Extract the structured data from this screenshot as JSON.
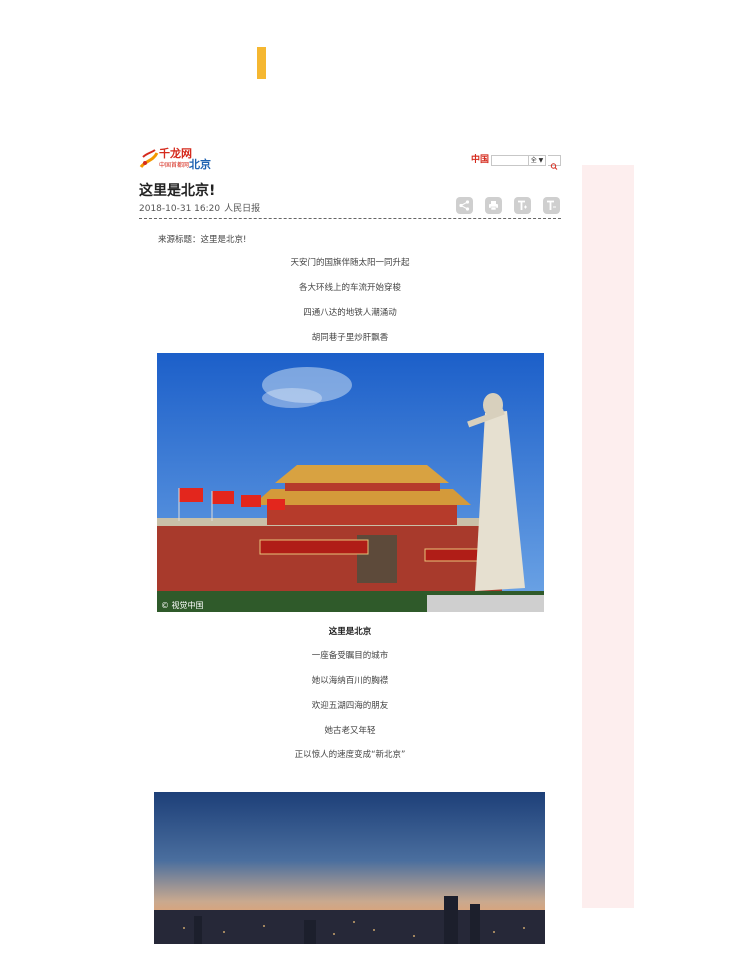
{
  "site": {
    "logo_name": "千龙网",
    "logo_sub": "中国首都网",
    "logo_city": "北京",
    "china_mark": "中国",
    "search_scope": "全 ▼"
  },
  "article": {
    "title": "这里是北京!",
    "date": "2018-10-31 16:20",
    "source": "人民日报",
    "lead": "来源标题：这里是北京!",
    "intro_lines": [
      "天安门的国旗伴随太阳一同升起",
      "各大环线上的车流开始穿梭",
      "四通八达的地铁人潮涌动",
      "胡同巷子里炒肝飘香"
    ],
    "photo1_watermark": "© 视觉中国",
    "photo1_caption": "这里是北京",
    "body_lines": [
      "一座备受瞩目的城市",
      "她以海纳百川的胸襟",
      "欢迎五湖四海的朋友",
      "她古老又年轻",
      "正以惊人的速度变成“新北京”"
    ]
  },
  "tools": [
    "share-icon",
    "print-icon",
    "font-larger-icon",
    "font-smaller-icon"
  ],
  "colors": {
    "accent": "#f5b731",
    "brand_red": "#d52b1e",
    "brand_blue": "#1c61b0",
    "side_panel": "#fdeeee"
  }
}
